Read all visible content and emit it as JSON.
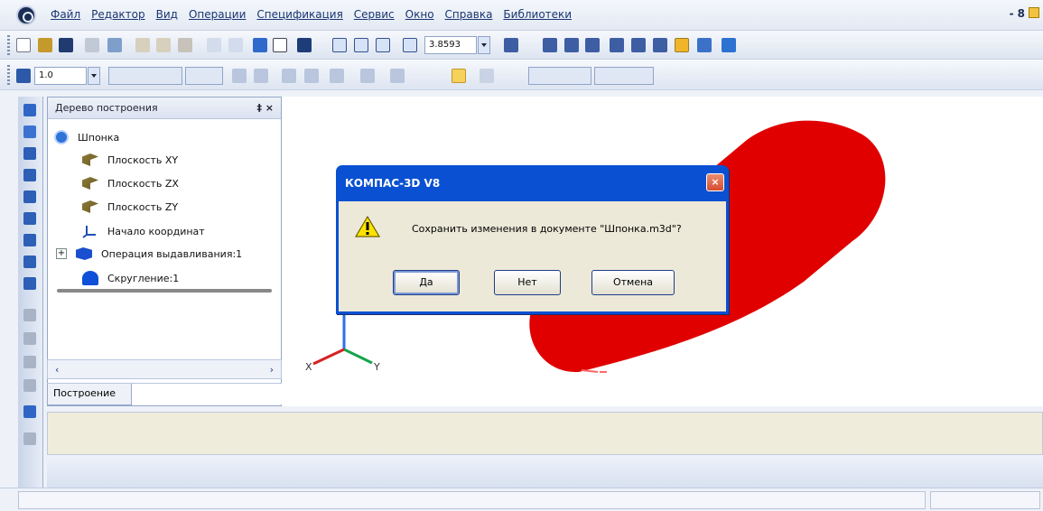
{
  "window": {
    "app_title": "КОМПАС-3D V8"
  },
  "menubar": {
    "items": [
      "Файл",
      "Редактор",
      "Вид",
      "Операции",
      "Спецификация",
      "Сервис",
      "Окно",
      "Справка",
      "Библиотеки"
    ],
    "window_controls": [
      "-",
      "8"
    ]
  },
  "toolbar1": {
    "zoom_value": "3.8593"
  },
  "toolbar2": {
    "step_value": "1.0"
  },
  "tree": {
    "title": "Дерево построения",
    "pin_label": "‡ ×",
    "root": "Шпонка",
    "items": [
      {
        "label": "Плоскость XY",
        "icon": "plane-icon"
      },
      {
        "label": "Плоскость ZX",
        "icon": "plane-icon"
      },
      {
        "label": "Плоскость ZY",
        "icon": "plane-icon"
      },
      {
        "label": "Начало координат",
        "icon": "axes-icon"
      },
      {
        "label": "Операция выдавливания:1",
        "icon": "extrude-icon"
      },
      {
        "label": "Скругление:1",
        "icon": "fillet-icon"
      }
    ]
  },
  "tabs": {
    "active": "Построение"
  },
  "canvas": {
    "axis_labels": {
      "x": "X",
      "y": "Y"
    },
    "model_color": "#e00000"
  },
  "dialog": {
    "title": "КОМПАС-3D V8",
    "message": "Сохранить изменения в документе \"Шпонка.m3d\"?",
    "buttons": {
      "yes": "Да",
      "no": "Нет",
      "cancel": "Отмена"
    }
  }
}
